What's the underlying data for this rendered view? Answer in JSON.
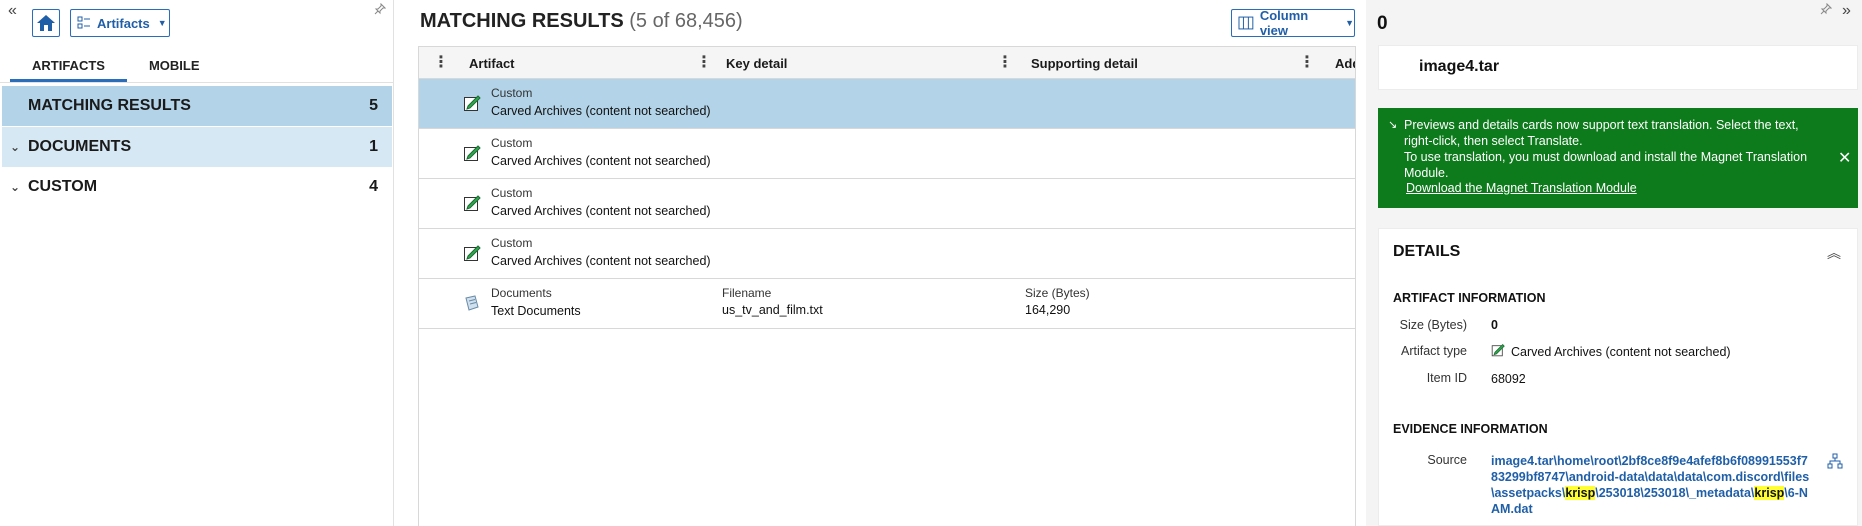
{
  "left": {
    "artifacts_button": "Artifacts",
    "tabs": [
      "ARTIFACTS",
      "MOBILE"
    ],
    "nav": [
      {
        "label": "MATCHING RESULTS",
        "count": "5"
      },
      {
        "label": "DOCUMENTS",
        "count": "1"
      },
      {
        "label": "CUSTOM",
        "count": "4"
      }
    ]
  },
  "center": {
    "title": "MATCHING RESULTS",
    "subtitle": "(5 of 68,456)",
    "column_view_label": "Column view",
    "headers": {
      "artifact": "Artifact",
      "key": "Key detail",
      "supporting": "Supporting detail",
      "additional": "Add"
    },
    "rows": [
      {
        "line1": "Custom",
        "line2": "Carved Archives (content not searched)",
        "key1": "",
        "key2": "",
        "sup1": "",
        "sup2": ""
      },
      {
        "line1": "Custom",
        "line2": "Carved Archives (content not searched)",
        "key1": "",
        "key2": "",
        "sup1": "",
        "sup2": ""
      },
      {
        "line1": "Custom",
        "line2": "Carved Archives (content not searched)",
        "key1": "",
        "key2": "",
        "sup1": "",
        "sup2": ""
      },
      {
        "line1": "Custom",
        "line2": "Carved Archives (content not searched)",
        "key1": "",
        "key2": "",
        "sup1": "",
        "sup2": ""
      },
      {
        "line1": "Documents",
        "line2": "Text Documents",
        "key1": "Filename",
        "key2": "us_tv_and_film.txt",
        "sup1": "Size (Bytes)",
        "sup2": "164,290"
      }
    ]
  },
  "right": {
    "count": "0",
    "item_title": "image4.tar",
    "banner": {
      "line1": "Previews and details cards now support text translation. Select the text, right-click, then select Translate.",
      "line2": "To use translation, you must download and install the Magnet Translation Module.",
      "link": "Download the Magnet Translation Module"
    },
    "details": {
      "title": "DETAILS",
      "artifact_info": "ARTIFACT INFORMATION",
      "size_label": "Size (Bytes)",
      "size_value": "0",
      "type_label": "Artifact type",
      "type_value": "Carved Archives (content not searched)",
      "id_label": "Item ID",
      "id_value": "68092",
      "evidence_info": "EVIDENCE INFORMATION",
      "source_label": "Source",
      "source_parts": [
        "image4.tar\\home\\root\\2bf8ce8f9e4afef8b6f08991553f783299bf8747\\android-data\\data\\data\\com.discord\\files\\assetpacks\\",
        "krisp",
        "\\253018\\253018\\_metadata\\",
        "krisp",
        "\\6-NAM.dat"
      ]
    }
  },
  "colors": {
    "accent": "#2a6ebb",
    "selected_row": "#b3d4e8",
    "banner_green": "#0d7a1c",
    "highlight": "#ffff33"
  }
}
